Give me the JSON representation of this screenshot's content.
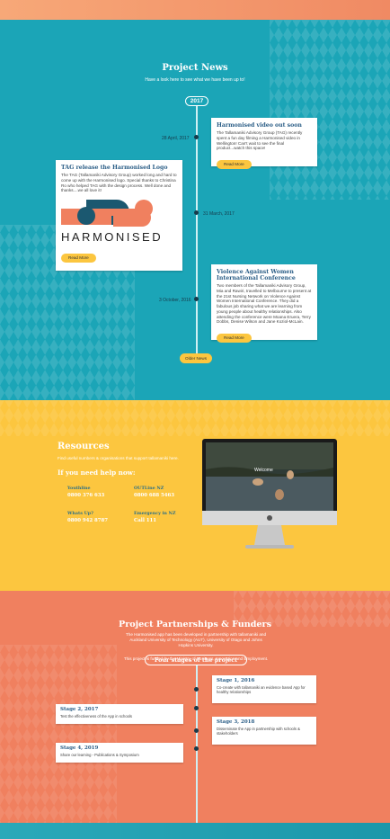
{
  "colors": {
    "teal": "#1ba5b7",
    "yellow": "#fcc63f",
    "coral": "#f0805f",
    "navy": "#173a4a",
    "title_blue": "#2a5d86"
  },
  "news": {
    "title": "Project News",
    "subtitle": "Have a look here to see what we have been up to!",
    "year": "2017",
    "items": [
      {
        "date": "28 April, 2017",
        "title": "Harmonised video out soon",
        "body": "The Tallamaniki Advisory Group (TAG) recently spent a fun day filming a Harmonised video in Wellington! Can't wait to see the final product...watch this space!",
        "button": "Read More"
      },
      {
        "date": "31 March, 2017",
        "title": "TAG release the Harmonised Logo",
        "body": "The TAG (Tallamaniki Advisory Group) worked long and hard to come up with the Harmonised logo. Special thanks to Christina Ro who helped TAG with the design process. Well done and thanks....we all love it!",
        "logo_text": "HARMONISED",
        "button": "Read More"
      },
      {
        "date": "3 October, 2016",
        "title": "Violence Against Women International Conference",
        "body": "Two members of the Tallamaniki Advisory Group, Mia and Rawiri, travelled to Melbourne to present at the 21st Nursing Network on Violence Against Women International Conference. They did a fabulous job sharing what we are learning from young people about healthy relationships. Also attending the conference were Moana Eruera, Terry Dobbs, Denise Wilson and Jane Koziol-McLain.",
        "button": "Read More"
      }
    ],
    "older_button": "Older News"
  },
  "resources": {
    "title": "Resources",
    "subtitle": "Find useful numbers & organisations that support tallamaniki here.",
    "help_heading": "If you need help now:",
    "contacts": [
      {
        "label": "Youthline",
        "number": "0800 376 633"
      },
      {
        "label": "OUTLine NZ",
        "number": "0800 688 5463"
      },
      {
        "label": "Whats Up?",
        "number": "0800 942 8787"
      },
      {
        "label": "Emergency in NZ",
        "number": "Call 111"
      }
    ],
    "screen_caption": "Welcome"
  },
  "partners": {
    "title": "Project Partnerships & Funders",
    "text1": "The Harmonised app has been developed in partnership with tallamaniki and Auckland University of Technology (AUT), University of Otago and Johns Hopkins University.",
    "text2": "This project is funded by the Ministry of Business, Innovation and Employment.",
    "stages_heading": "Four stages of the project",
    "stages": [
      {
        "title": "Stage 1, 2016",
        "body": "Co-create with tallamaniki an evidence based App for healthy relationships"
      },
      {
        "title": "Stage 2, 2017",
        "body": "Test the effectiveness of the App in schools"
      },
      {
        "title": "Stage 3, 2018",
        "body": "Disseminate the App in partnership with schools & stakeholders"
      },
      {
        "title": "Stage 4, 2019",
        "body": "Share our learning - Publications & Symposium"
      }
    ]
  }
}
